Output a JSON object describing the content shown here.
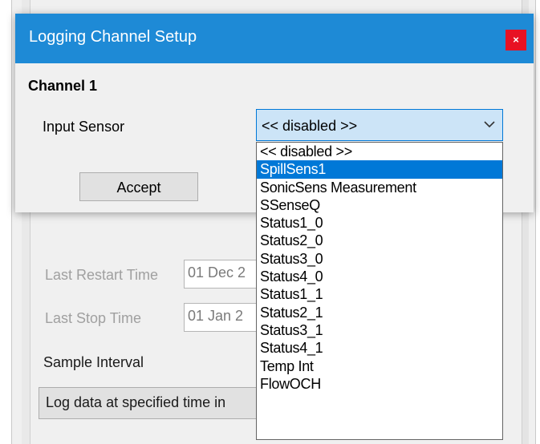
{
  "background": {
    "last_restart_label": "Last Restart Time",
    "last_restart_value": "01 Dec 2",
    "last_stop_label": "Last Stop Time",
    "last_stop_value": "01 Jan 2",
    "sample_interval_label": "Sample Interval",
    "sample_interval_value": "Log data at specified time in"
  },
  "dialog": {
    "title": "Logging Channel Setup",
    "close_label": "×",
    "channel_heading": "Channel 1",
    "input_sensor_label": "Input Sensor",
    "input_sensor_value": "<< disabled >>",
    "accept_label": "Accept"
  },
  "dropdown": {
    "selected_index": 1,
    "items": [
      "<< disabled >>",
      "SpillSens1",
      "SonicSens Measurement",
      "SSenseQ",
      "Status1_0",
      "Status2_0",
      "Status3_0",
      "Status4_0",
      "Status1_1",
      "Status2_1",
      "Status3_1",
      "Status4_1",
      "Temp Int",
      "FlowOCH"
    ]
  },
  "colors": {
    "titlebar": "#1e8ad6",
    "close": "#e81123",
    "selection": "#0078d7",
    "combo_focus": "#cce4f7"
  },
  "icons": {
    "close": "close-icon",
    "chevron": "chevron-down-icon"
  }
}
